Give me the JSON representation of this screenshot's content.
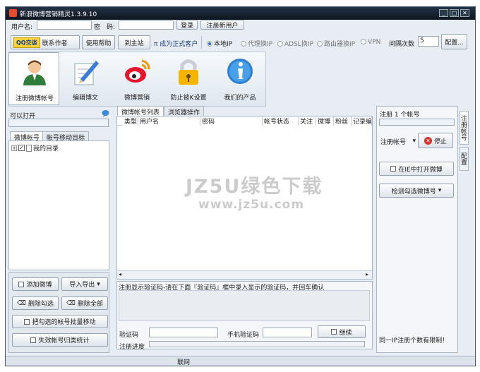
{
  "window": {
    "title": "新浪微博营销精灵1.3.9.10",
    "min": "_",
    "max": "□",
    "close": "✕"
  },
  "login": {
    "username_label": "用户名:",
    "username_value": "",
    "password_label": "密　码:",
    "password_value": "",
    "login_button": "登录",
    "register_button": "注册新用户"
  },
  "toolbar": {
    "qq_button": "QQ交谈",
    "contact_author": "联系作者",
    "help_button": "使用帮助",
    "site_button": "到主站",
    "pi_link": "π 成为正式客户",
    "ip_modes": [
      "本地IP",
      "代理换IP",
      "ADSL换IP",
      "路由器换IP",
      "VPN"
    ],
    "ip_selected": 0,
    "interval_label": "间隔次数",
    "interval_value": "5",
    "config_button": "配置..."
  },
  "tools": [
    {
      "label": "注册微博帐号",
      "icon": "user-icon"
    },
    {
      "label": "编辑博文",
      "icon": "pencil-icon"
    },
    {
      "label": "微博营销",
      "icon": "weibo-icon"
    },
    {
      "label": "防止被K设置",
      "icon": "lock-icon"
    },
    {
      "label": "我们的产品",
      "icon": "info-icon"
    }
  ],
  "left": {
    "openable_label": "可以打开",
    "tabs": [
      "微博帐号",
      "帐号移动目标"
    ],
    "tree_root": "我的目录",
    "add_button": "添加微博",
    "import_button": "导入导出",
    "delete_checked": "删除勾选",
    "delete_all": "删除全部",
    "move_checked": "把勾选的帐号批量移动",
    "stats_button": "失效帐号归类统计"
  },
  "center": {
    "tabs": [
      "微博帐号列表",
      "浏览器操作"
    ],
    "columns": [
      "类型",
      "用户名",
      "密码",
      "帐号状态",
      "关注",
      "微博",
      "粉丝",
      "记录编"
    ],
    "captcha_hint": "注册显示验证码-请在下面『验证码』框中录入显示的验证码，并回车确认",
    "captcha_label": "验证码",
    "phone_label": "手机验证码",
    "continue_button": "继续",
    "progress_label": "注册进度"
  },
  "right": {
    "register_count": "注册 1 个帐号",
    "select_value": "注册帐号",
    "stop_button": "停止",
    "open_ie_button": "在IE中打开微博",
    "check_button": "检测勾选微博号",
    "limit_note": "同一IP注册个数有限制！",
    "side_tabs": [
      "注册帐号",
      "配置"
    ]
  },
  "status": {
    "text": "联网"
  },
  "watermark": {
    "line1": "JZ5U绿色下载",
    "line2": "www.jz5u.com"
  },
  "colors": {
    "titlebar": "#0d1520",
    "accent": "#2a6ac8",
    "stop": "#d9302c"
  }
}
